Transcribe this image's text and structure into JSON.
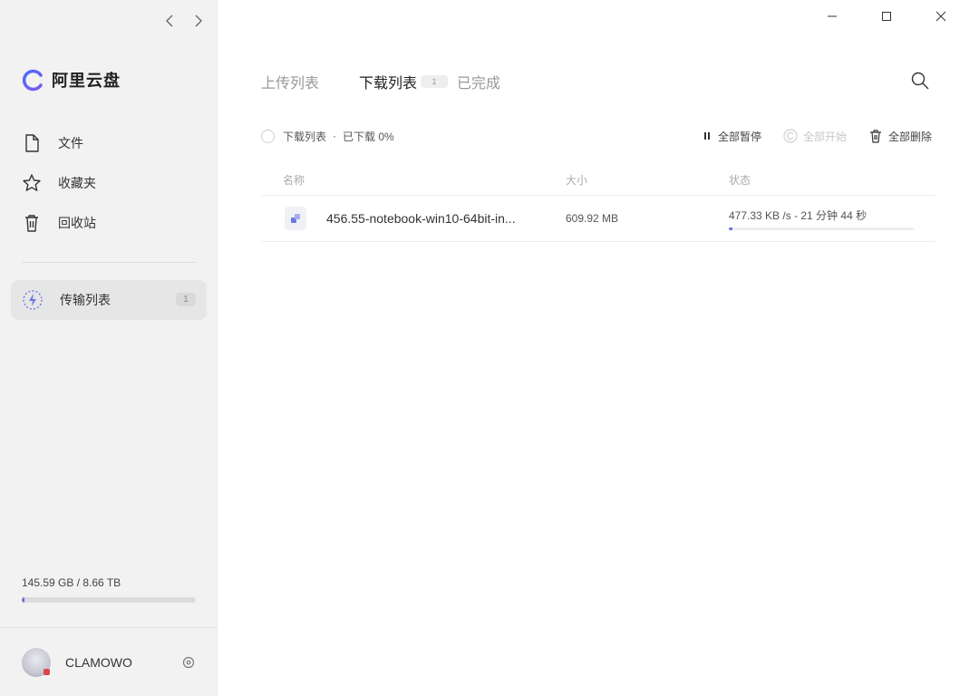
{
  "sidebar": {
    "logo_text": "阿里云盘",
    "menu": [
      {
        "label": "文件",
        "icon": "file-icon"
      },
      {
        "label": "收藏夹",
        "icon": "star-icon"
      },
      {
        "label": "回收站",
        "icon": "trash-icon"
      }
    ],
    "transfer": {
      "label": "传输列表",
      "count": "1",
      "icon": "lightning-icon"
    },
    "storage": {
      "text": "145.59 GB / 8.66 TB",
      "used_fraction": 0.017
    },
    "user": {
      "name": "CLAMOWO"
    }
  },
  "tabs": [
    {
      "label": "上传列表",
      "active": false
    },
    {
      "label": "下载列表",
      "active": true,
      "badge": "1"
    },
    {
      "label": "已完成",
      "active": false
    }
  ],
  "toolbar": {
    "select_label": "下载列表",
    "separator": "·",
    "progress_label": "已下载 0%",
    "pause_all": "全部暂停",
    "start_all": "全部开始",
    "delete_all": "全部删除"
  },
  "table": {
    "headers": {
      "name": "名称",
      "size": "大小",
      "status": "状态"
    },
    "rows": [
      {
        "name": "456.55-notebook-win10-64bit-in...",
        "size": "609.92 MB",
        "status": "477.33 KB /s - 21 分钟 44 秒",
        "progress_fraction": 0.02
      }
    ]
  },
  "colors": {
    "accent": "#6b78e5",
    "sidebar_bg": "#f2f2f2"
  }
}
